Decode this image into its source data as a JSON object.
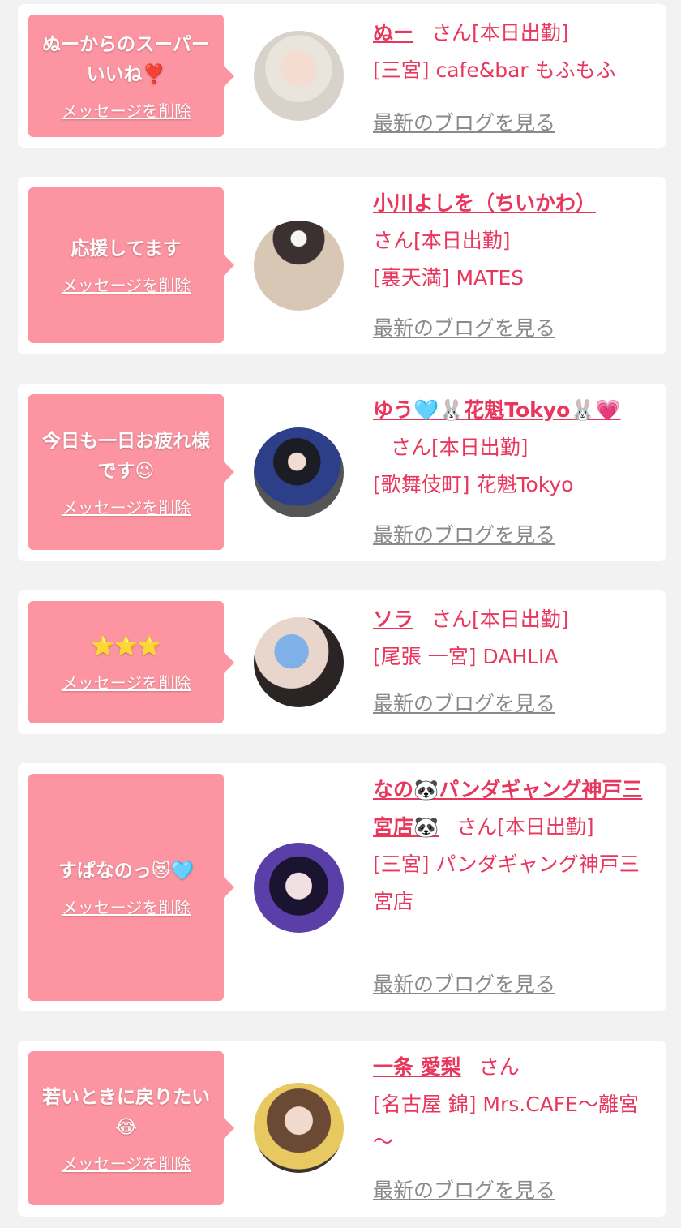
{
  "delete_label": "メッセージを削除",
  "blog_label": "最新のブログを見る",
  "san_suffix": "さん",
  "colors": {
    "bubble": "#fc94a1",
    "accent": "#e8365d",
    "link_gray": "#8a8a8a",
    "background": "#f2f2f2"
  },
  "items": [
    {
      "message": "ぬーからのスーパーいいね❣️",
      "name": "ぬー",
      "san_status": "さん[本日出勤]",
      "shop": "[三宮] cafe&bar もふもふ"
    },
    {
      "message": "応援してます",
      "name": "小川よしを（ちいかわ）",
      "san_status": "さん[本日出勤]",
      "shop": "[裏天満] MATES"
    },
    {
      "message": "今日も一日お疲れ様です😉",
      "name": "ゆう🩵🐰花魁Tokyo🐰💗",
      "san_status": "さん[本日出勤]",
      "shop": "[歌舞伎町] 花魁Tokyo"
    },
    {
      "message": "⭐⭐⭐",
      "name": "ソラ",
      "san_status": "さん[本日出勤]",
      "shop": "[尾張 一宮] DAHLIA"
    },
    {
      "message": "すぱなのっ😻🩵",
      "name": "なの🐼パンダギャング神戸三宮店🐼",
      "san_status": "さん[本日出勤]",
      "shop": "[三宮] パンダギャング神戸三宮店"
    },
    {
      "message": "若いときに戻りたい😂",
      "name": "一条 愛梨",
      "san_status": "さん",
      "shop": "[名古屋 錦] Mrs.CAFE～離宮～"
    }
  ]
}
